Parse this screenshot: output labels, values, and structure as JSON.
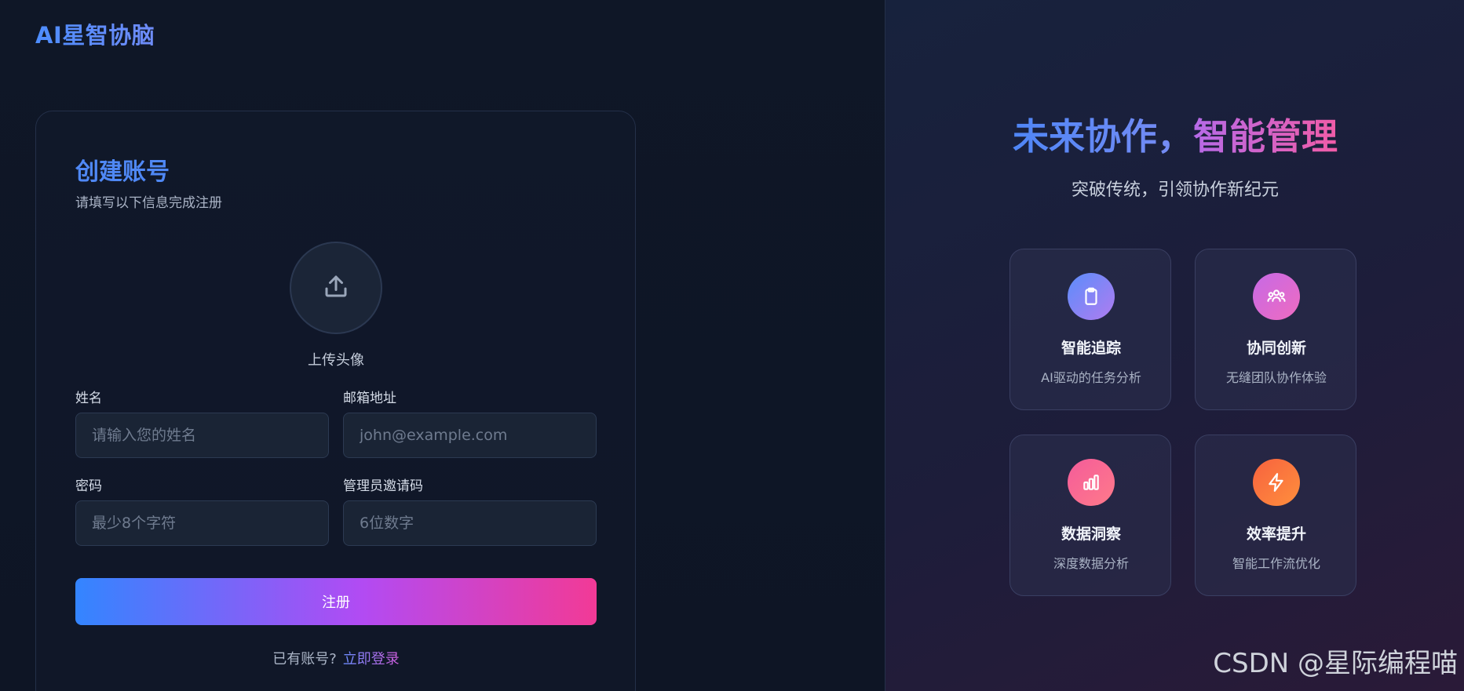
{
  "brand": {
    "logo": "AI星智协脑"
  },
  "form": {
    "title": "创建账号",
    "subtitle": "请填写以下信息完成注册",
    "avatar_label": "上传头像",
    "fields": {
      "name": {
        "label": "姓名",
        "placeholder": "请输入您的姓名",
        "value": ""
      },
      "email": {
        "label": "邮箱地址",
        "placeholder": "john@example.com",
        "value": ""
      },
      "password": {
        "label": "密码",
        "placeholder": "最少8个字符",
        "value": ""
      },
      "invite": {
        "label": "管理员邀请码",
        "placeholder": "6位数字",
        "value": ""
      }
    },
    "submit_label": "注册",
    "login_prompt": "已有账号?",
    "login_link": "立即登录"
  },
  "hero": {
    "title_part1": "未来协作，",
    "title_part2": "智能管理",
    "subtitle": "突破传统，引领协作新纪元"
  },
  "features": [
    {
      "title": "智能追踪",
      "desc": "AI驱动的任务分析",
      "icon": "clipboard-icon",
      "colors": [
        "#5b8dfb",
        "#b07cf0"
      ]
    },
    {
      "title": "协同创新",
      "desc": "无缝团队协作体验",
      "icon": "team-icon",
      "colors": [
        "#c66ae6",
        "#ef6bc0"
      ]
    },
    {
      "title": "数据洞察",
      "desc": "深度数据分析",
      "icon": "bar-chart-icon",
      "colors": [
        "#f45c9a",
        "#ff7a8a"
      ]
    },
    {
      "title": "效率提升",
      "desc": "智能工作流优化",
      "icon": "lightning-icon",
      "colors": [
        "#f7623e",
        "#ff8f3d"
      ]
    }
  ],
  "watermark": "CSDN @星际编程喵",
  "colors": {
    "accent_blue": "#3385ff",
    "accent_purple": "#b24bf3",
    "accent_pink": "#f23a96"
  }
}
